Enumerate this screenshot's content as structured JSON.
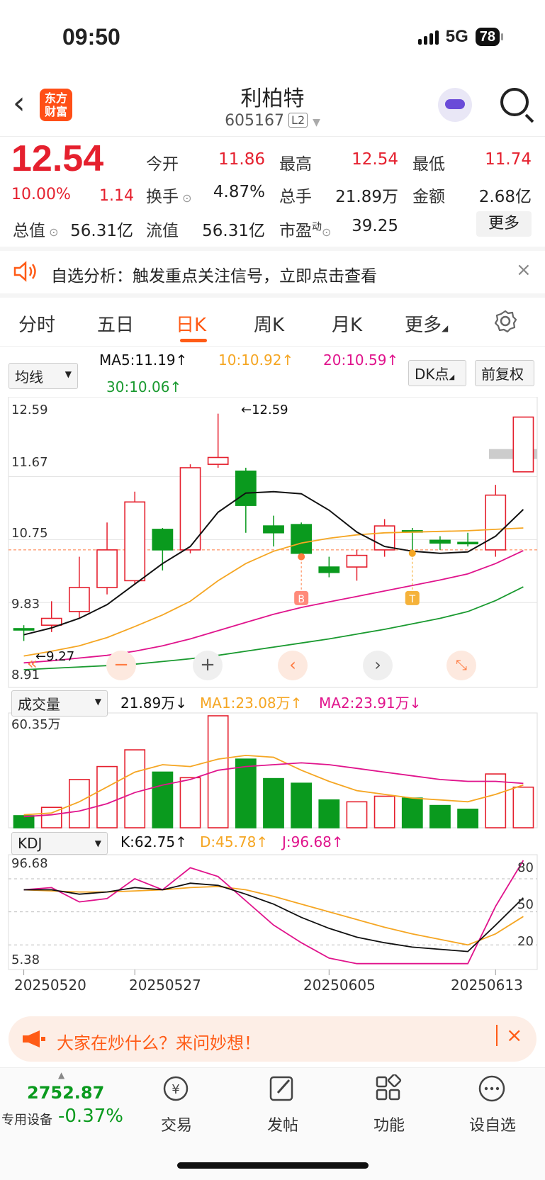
{
  "status": {
    "time": "09:50",
    "network": "5G",
    "battery": "78"
  },
  "header": {
    "logo_line1": "东方",
    "logo_line2": "财富",
    "title": "利柏特",
    "code": "605167",
    "level": "L2"
  },
  "quote": {
    "price": "12.54",
    "change_pct": "10.00%",
    "change": "1.14",
    "open_label": "今开",
    "open": "11.86",
    "high_label": "最高",
    "high": "12.54",
    "low_label": "最低",
    "low": "11.74",
    "turnover_label": "换手",
    "turnover": "4.87%",
    "volume_label": "总手",
    "volume": "21.89万",
    "amount_label": "金额",
    "amount": "2.68亿",
    "total_mv_label": "总值",
    "total_mv": "56.31亿",
    "float_mv_label": "流值",
    "float_mv": "56.31亿",
    "pe_label": "市盈",
    "pe_sup": "动",
    "pe": "39.25",
    "more": "更多"
  },
  "alert": {
    "text": "自选分析：触发重点关注信号，立即点击查看"
  },
  "tabs": [
    "分时",
    "五日",
    "日K",
    "周K",
    "月K",
    "更多"
  ],
  "ma": {
    "select": "均线",
    "ma5": "MA5:11.19↑",
    "ma10": "10:10.92↑",
    "ma20": "20:10.59↑",
    "ma30": "30:10.06↑",
    "dk": "DK点",
    "adjust": "前复权"
  },
  "price_axis": [
    "12.59",
    "11.67",
    "10.75",
    "9.83",
    "8.91"
  ],
  "annotations": {
    "high": "←12.59",
    "low": "←9.27",
    "buy": "B",
    "t": "T"
  },
  "volume": {
    "select": "成交量",
    "value": "21.89万↓",
    "ma1": "MA1:23.08万↑",
    "ma2": "MA2:23.91万↓",
    "max": "60.35万"
  },
  "kdj": {
    "select": "KDJ",
    "k": "K:62.75↑",
    "d": "D:45.78↑",
    "j": "J:96.68↑",
    "max": "96.68",
    "min": "5.38",
    "levels": [
      "80",
      "50",
      "20"
    ]
  },
  "dates": [
    "20250520",
    "20250527",
    "20250605",
    "20250613"
  ],
  "banner": {
    "text": "大家在炒什么？来问妙想！"
  },
  "bottom_nav": {
    "index_value": "2752.87",
    "index_label": "专用设备",
    "index_change": "-0.37%",
    "items": [
      "交易",
      "发帖",
      "功能",
      "设自选"
    ]
  },
  "colors": {
    "up": "#e5202e",
    "down": "#0a9a1e",
    "accent": "#ff5b16",
    "ma5": "#111111",
    "ma10": "#f5a623",
    "ma20": "#e0148c",
    "ma30": "#1a9a30"
  },
  "chart_data": {
    "type": "candlestick",
    "dates_shown": [
      "20250520",
      "20250527",
      "20250605",
      "20250613"
    ],
    "y_axis": [
      8.91,
      12.59
    ],
    "candles": [
      {
        "o": 9.45,
        "c": 9.43,
        "h": 9.5,
        "l": 9.27
      },
      {
        "o": 9.5,
        "c": 9.6,
        "h": 9.85,
        "l": 9.4
      },
      {
        "o": 9.7,
        "c": 10.05,
        "h": 10.5,
        "l": 9.6
      },
      {
        "o": 10.05,
        "c": 10.6,
        "h": 11.0,
        "l": 9.95
      },
      {
        "o": 10.15,
        "c": 11.3,
        "h": 11.45,
        "l": 10.1
      },
      {
        "o": 10.9,
        "c": 10.6,
        "h": 10.92,
        "l": 10.3
      },
      {
        "o": 10.6,
        "c": 11.8,
        "h": 11.85,
        "l": 10.55
      },
      {
        "o": 11.85,
        "c": 11.95,
        "h": 12.59,
        "l": 11.8
      },
      {
        "o": 11.75,
        "c": 11.25,
        "h": 11.8,
        "l": 10.85
      },
      {
        "o": 10.95,
        "c": 10.85,
        "h": 11.1,
        "l": 10.65
      },
      {
        "o": 10.97,
        "c": 10.55,
        "h": 11.0,
        "l": 10.5
      },
      {
        "o": 10.35,
        "c": 10.27,
        "h": 10.5,
        "l": 10.2
      },
      {
        "o": 10.35,
        "c": 10.52,
        "h": 10.6,
        "l": 10.15
      },
      {
        "o": 10.6,
        "c": 10.95,
        "h": 11.05,
        "l": 10.5
      },
      {
        "o": 10.88,
        "c": 10.86,
        "h": 10.92,
        "l": 10.5
      },
      {
        "o": 10.74,
        "c": 10.7,
        "h": 10.8,
        "l": 10.6
      },
      {
        "o": 10.71,
        "c": 10.69,
        "h": 10.85,
        "l": 10.65
      },
      {
        "o": 10.6,
        "c": 11.4,
        "h": 11.55,
        "l": 10.5
      },
      {
        "o": 11.74,
        "c": 12.54,
        "h": 12.54,
        "l": 11.74
      }
    ],
    "ma5": [
      9.36,
      9.46,
      9.6,
      9.8,
      10.1,
      10.4,
      10.65,
      11.15,
      11.43,
      11.45,
      11.42,
      11.18,
      10.86,
      10.65,
      10.58,
      10.55,
      10.57,
      10.8,
      11.19
    ],
    "ma10": [
      9.05,
      9.12,
      9.2,
      9.32,
      9.48,
      9.65,
      9.85,
      10.15,
      10.4,
      10.58,
      10.7,
      10.77,
      10.82,
      10.85,
      10.86,
      10.87,
      10.88,
      10.9,
      10.92
    ],
    "ma20": [
      8.95,
      8.98,
      9.02,
      9.06,
      9.12,
      9.2,
      9.3,
      9.42,
      9.54,
      9.66,
      9.76,
      9.84,
      9.92,
      10.0,
      10.08,
      10.16,
      10.25,
      10.4,
      10.59
    ],
    "ma30": [
      8.85,
      8.87,
      8.89,
      8.91,
      8.93,
      8.97,
      9.01,
      9.06,
      9.12,
      9.18,
      9.24,
      9.3,
      9.37,
      9.44,
      9.52,
      9.6,
      9.7,
      9.86,
      10.06
    ],
    "volume": [
      6.5,
      11.0,
      26.0,
      33.0,
      42.0,
      30.0,
      27.0,
      60.35,
      37.0,
      26.5,
      24.0,
      15.0,
      14.0,
      17.0,
      16.0,
      12.0,
      10.0,
      29.0,
      21.89
    ],
    "vol_ma1": [
      7,
      8,
      14,
      22,
      30,
      34,
      33,
      37,
      39,
      38,
      31,
      25,
      20,
      18,
      16,
      15,
      14,
      18,
      23.08
    ],
    "vol_ma2": [
      6,
      7,
      9,
      13,
      19,
      23,
      26,
      31,
      33,
      34,
      35,
      34,
      32,
      30,
      28,
      26,
      25,
      25,
      23.91
    ],
    "kdj_k": [
      70,
      70,
      66,
      68,
      72,
      70,
      76,
      74,
      66,
      57,
      45,
      35,
      27,
      22,
      18,
      16,
      14,
      38,
      62.75
    ],
    "kdj_d": [
      70,
      69,
      68,
      68,
      69,
      70,
      72,
      73,
      70,
      64,
      57,
      50,
      43,
      36,
      30,
      25,
      20,
      30,
      45.78
    ],
    "kdj_j": [
      70,
      72,
      59,
      62,
      80,
      70,
      90,
      82,
      60,
      38,
      22,
      8,
      3,
      3,
      3,
      3,
      3,
      55,
      96.68
    ]
  }
}
